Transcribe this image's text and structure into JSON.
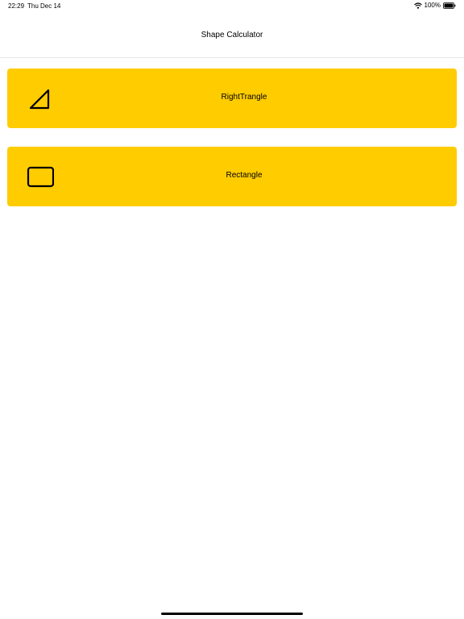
{
  "status_bar": {
    "time": "22:29",
    "date": "Thu Dec 14",
    "battery_percent": "100%",
    "icons": [
      "wifi-icon",
      "battery-icon"
    ]
  },
  "nav": {
    "title": "Shape Calculator"
  },
  "shapes": [
    {
      "label": "RightTrangle",
      "icon": "right-triangle-icon"
    },
    {
      "label": "Rectangle",
      "icon": "rectangle-icon"
    }
  ],
  "colors": {
    "card_background": "#ffcc00",
    "page_background": "#ffffff",
    "text": "#000000"
  }
}
